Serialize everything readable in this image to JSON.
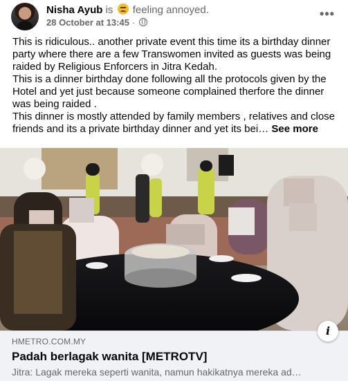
{
  "post": {
    "author_name": "Nisha Ayub",
    "feeling_prefix": "is",
    "feeling_text": "feeling annoyed.",
    "feeling_icon": "annoyed-face-icon",
    "date": "28 October at 13:45",
    "separator": "·",
    "privacy_icon": "globe-icon",
    "more_label": "•••",
    "text_lines": [
      "This is ridiculous..  another private event this time its a birthday dinner party  where there are a few Transwomen  invited as guests was being raided by Religious Enforcers in Jitra Kedah.",
      "This is a dinner birthday  done following all the protocols given by the Hotel and yet just because someone complained therfore the dinner was being raided .",
      "This dinner is mostly attended by family members , relatives and close friends and its a private birthday dinner and yet its bei…"
    ],
    "see_more_label": "See more"
  },
  "link_preview": {
    "domain": "HMETRO.COM.MY",
    "title": "Padah berlagak wanita [METROTV]",
    "description": "Jitra: Lagak mereka seperti wanita, namun hakikatnya mereka ad…",
    "info_label": "i"
  },
  "colors": {
    "text_primary": "#050505",
    "text_secondary": "#65676b",
    "link_box_bg": "#f0f2f5",
    "emoji_yellow": "#f7b928"
  }
}
